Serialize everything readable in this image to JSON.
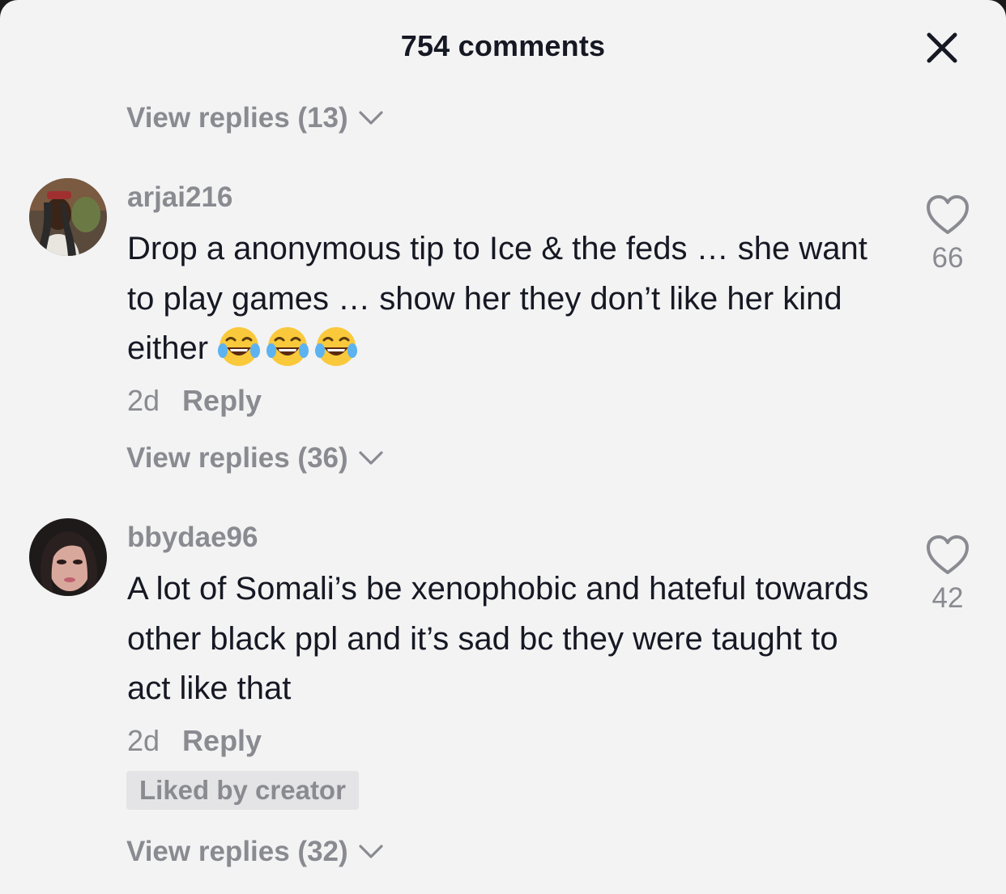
{
  "header": {
    "title": "754 comments",
    "close_icon": "close-icon"
  },
  "top_view_replies": "View replies (13)",
  "comments": [
    {
      "username": "arjai216",
      "text": "Drop a anonymous tip to Ice & the feds … she want to play games … show her they don’t like her kind either",
      "emoji": [
        "face-with-tears-of-joy",
        "face-with-tears-of-joy",
        "face-with-tears-of-joy"
      ],
      "time": "2d",
      "reply_label": "Reply",
      "likes": "66",
      "view_replies": "View replies (36)"
    },
    {
      "username": "bbydae96",
      "text": "A lot of Somali’s be xenophobic and hateful towards other black ppl and it’s sad bc they were taught to act like that",
      "time": "2d",
      "reply_label": "Reply",
      "likes": "42",
      "badge": "Liked by creator",
      "view_replies": "View replies (32)"
    }
  ],
  "colors": {
    "background": "#f3f3f4",
    "primary_text": "#161823",
    "secondary_text": "#8a8b91",
    "badge_bg": "#e4e4e6"
  }
}
